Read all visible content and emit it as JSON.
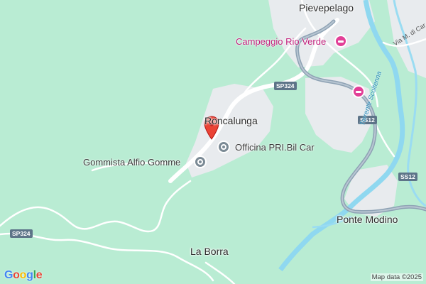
{
  "map": {
    "places": {
      "pievepelago": "Pievepelago",
      "roncalunga": "Roncalunga",
      "la_borra": "La Borra",
      "ponte_modino": "Ponte Modino"
    },
    "pois": {
      "campeggio": "Campeggio Rio Verde",
      "officina": "Officina PRI.Bil Car",
      "gommista": "Gommista Alfio Gomme"
    },
    "roads": {
      "sp324_a": "SP324",
      "sp324_b": "SP324",
      "ss12_a": "SS12",
      "ss12_b": "SS12",
      "via": "Via M. di Car"
    },
    "water": {
      "torrente": "Torrente Scoltenna"
    },
    "attribution": "Map data ©2025",
    "logo_letters": [
      "G",
      "o",
      "o",
      "g",
      "l",
      "e"
    ],
    "logo_colors": [
      "#4285F4",
      "#EA4335",
      "#FBBC05",
      "#4285F4",
      "#34A853",
      "#EA4335"
    ],
    "colors": {
      "land": "#b9ecd3",
      "settlement": "#e8ebee",
      "road": "#ffffff",
      "highway": "#8ea2b4",
      "river": "#8fd8f0",
      "marker": "#ea4335"
    },
    "icons": {
      "marker": "location-pin-icon",
      "officina": "car-repair-icon",
      "gommista": "car-repair-icon",
      "campeggio": "hotel-bed-icon",
      "hotel": "hotel-bed-icon"
    }
  }
}
